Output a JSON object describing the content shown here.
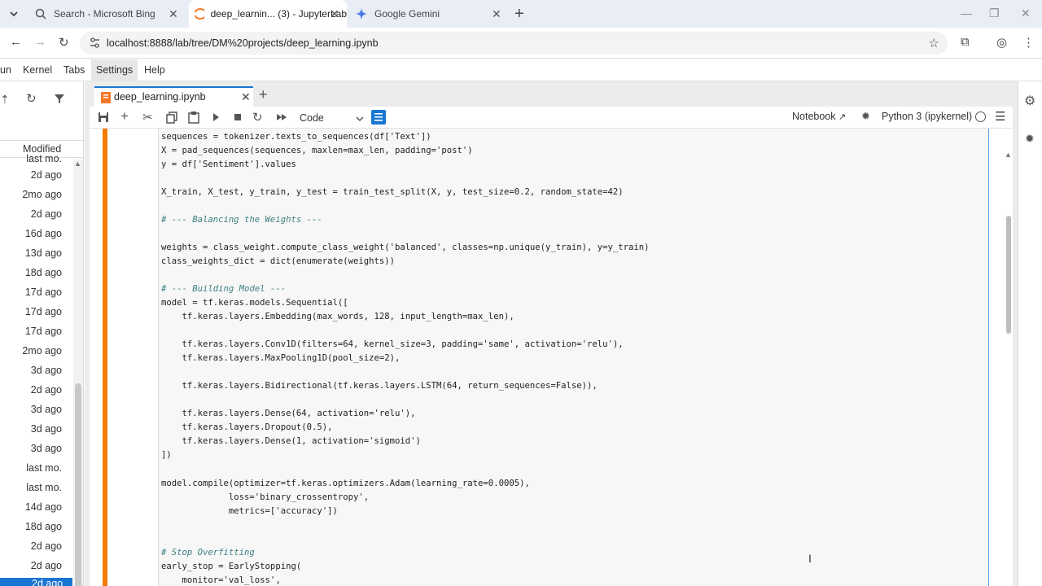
{
  "browser": {
    "tabs": [
      {
        "title": "Search - Microsoft Bing"
      },
      {
        "title": "deep_learnin... (3) - JupyterLab"
      },
      {
        "title": "Google Gemini"
      }
    ],
    "url": "localhost:8888/lab/tree/DM%20projects/deep_learning.ipynb"
  },
  "menubar": {
    "items": [
      "un",
      "Kernel",
      "Tabs",
      "Settings",
      "Help"
    ]
  },
  "filebrowser": {
    "column_header": "Modified",
    "dates": [
      "last mo.",
      "2d ago",
      "2mo ago",
      "2d ago",
      "16d ago",
      "13d ago",
      "18d ago",
      "17d ago",
      "17d ago",
      "17d ago",
      "2mo ago",
      "3d ago",
      "2d ago",
      "3d ago",
      "3d ago",
      "3d ago",
      "last mo.",
      "last mo.",
      "14d ago",
      "18d ago",
      "2d ago",
      "2d ago",
      "2d ago"
    ]
  },
  "notebook": {
    "tab_title": "deep_learning.ipynb",
    "cell_type": "Code",
    "notebook_link": "Notebook",
    "kernel_name": "Python 3 (ipykernel)"
  },
  "code_lines": [
    "sequences = tokenizer.texts_to_sequences(df['Text'])",
    "X = pad_sequences(sequences, maxlen=max_len, padding='post')",
    "y = df['Sentiment'].values",
    "",
    "X_train, X_test, y_train, y_test = train_test_split(X, y, test_size=0.2, random_state=42)",
    "",
    "# --- Balancing the Weights ---",
    "",
    "weights = class_weight.compute_class_weight('balanced', classes=np.unique(y_train), y=y_train)",
    "class_weights_dict = dict(enumerate(weights))",
    "",
    "# --- Building Model ---",
    "model = tf.keras.models.Sequential([",
    "    tf.keras.layers.Embedding(max_words, 128, input_length=max_len),",
    "",
    "    tf.keras.layers.Conv1D(filters=64, kernel_size=3, padding='same', activation='relu'),",
    "    tf.keras.layers.MaxPooling1D(pool_size=2),",
    "",
    "    tf.keras.layers.Bidirectional(tf.keras.layers.LSTM(64, return_sequences=False)),",
    "",
    "    tf.keras.layers.Dense(64, activation='relu'),",
    "    tf.keras.layers.Dropout(0.5),",
    "    tf.keras.layers.Dense(1, activation='sigmoid')",
    "])",
    "",
    "model.compile(optimizer=tf.keras.optimizers.Adam(learning_rate=0.0005),",
    "             loss='binary_crossentropy',",
    "             metrics=['accuracy'])",
    "",
    "",
    "# Stop Overfitting",
    "early_stop = EarlyStopping(",
    "    monitor='val_loss',"
  ],
  "colors": {
    "accent": "#1976d2",
    "cell_active_bar": "#f57c00",
    "code_keyword": "#008000",
    "code_string": "#ba2121",
    "code_number": "#098658",
    "code_comment": "#408080"
  }
}
